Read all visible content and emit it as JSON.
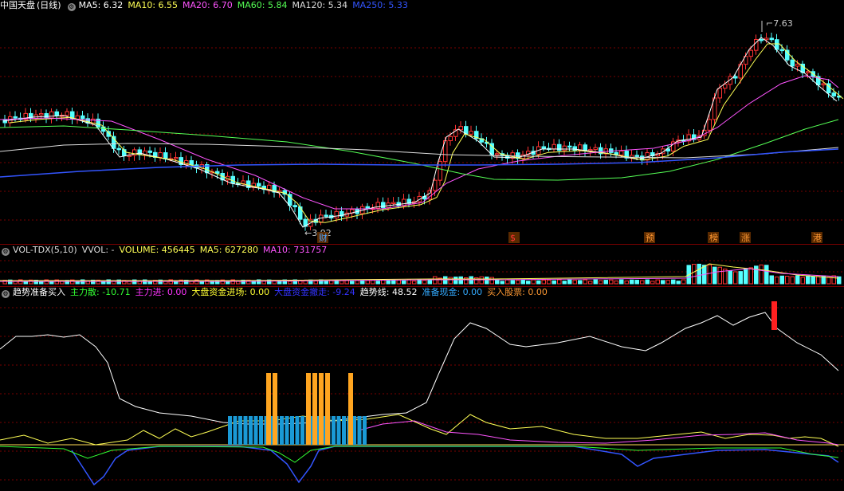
{
  "main": {
    "title": "中国天盘",
    "period": "(日线)",
    "ma": [
      {
        "label": "MA5: 6.32",
        "color": "#ffffff"
      },
      {
        "label": "MA10: 6.55",
        "color": "#ffff55"
      },
      {
        "label": "MA20: 6.70",
        "color": "#ff55ff"
      },
      {
        "label": "MA60: 5.84",
        "color": "#55ff55"
      },
      {
        "label": "MA120: 5.34",
        "color": "#dddddd"
      },
      {
        "label": "MA250: 5.33",
        "color": "#3355ff"
      }
    ],
    "high_label": "7.63",
    "low_label": "3.92",
    "markers": [
      {
        "text": "财",
        "color": "#4aa3ff"
      },
      {
        "text": "$",
        "color": "#ff3333"
      },
      {
        "text": "预",
        "color": "#ff9933"
      },
      {
        "text": "榜",
        "color": "#ff9933"
      },
      {
        "text": "涨",
        "color": "#ff9933"
      },
      {
        "text": "港",
        "color": "#ff9933"
      }
    ]
  },
  "volume": {
    "name": "VOL-TDX(5,10)",
    "items": [
      {
        "label": "VVOL: -",
        "color": "#dddddd"
      },
      {
        "label": "VOLUME: 456445",
        "color": "#ffff55"
      },
      {
        "label": "MA5: 627280",
        "color": "#ffff55"
      },
      {
        "label": "MA10: 731757",
        "color": "#ff55ff"
      }
    ]
  },
  "indicator": {
    "name": "趋势准备买入",
    "items": [
      {
        "label": "主力散: -10.71",
        "color": "#33ff33"
      },
      {
        "label": "主力进: 0.00",
        "color": "#ff33ff"
      },
      {
        "label": "大盘资金进场: 0.00",
        "color": "#ffff33"
      },
      {
        "label": "大盘资金撤走: -9.24",
        "color": "#3333ff"
      },
      {
        "label": "趋势线: 48.52",
        "color": "#ffffff"
      },
      {
        "label": "准备现金: 0.00",
        "color": "#33aaff"
      },
      {
        "label": "买入股票: 0.00",
        "color": "#ff9933"
      }
    ]
  },
  "colors": {
    "up": "#ff3333",
    "down": "#55ffff",
    "grid": "#7a0000"
  }
}
